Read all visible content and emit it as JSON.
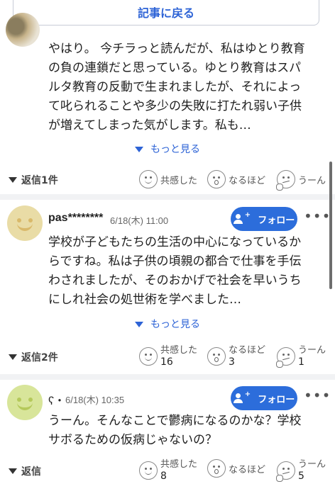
{
  "header": {
    "back_label": "記事に戻る"
  },
  "comments": [
    {
      "lines": [
        "やはり。 今チラっと読んだが、私はゆとり教育",
        "の負の連鎖だと思っている。ゆとり教育はスパ",
        "ルタ教育の反動で生まれましたが、それによっ",
        "て叱られることや多少の失敗に打たれ弱い子供",
        "が増えてしまった気がします。私も…"
      ],
      "more_label": "もっと見る",
      "reply_label": "返信1件",
      "reactions": {
        "empathy": {
          "label": "共感した"
        },
        "insight": {
          "label": "なるほど"
        },
        "hmm": {
          "label": "うーん"
        }
      }
    },
    {
      "username": "pas********",
      "date": "6/18(木) 11:00",
      "follow_label": "フォロー",
      "lines": [
        "学校が子どもたちの生活の中心になっているか",
        "らですね。私は子供の頃親の都合で仕事を手伝",
        "わされましたが、そのおかげで社会を早いうち",
        "にしれ社会の処世術を学べました…"
      ],
      "more_label": "もっと見る",
      "reply_label": "返信2件",
      "reactions": {
        "empathy": {
          "label": "共感した",
          "count": "16"
        },
        "insight": {
          "label": "なるほど",
          "count": "3"
        },
        "hmm": {
          "label": "うーん",
          "count": "1"
        }
      }
    },
    {
      "username": "ʕ・",
      "date": "6/18(木) 10:35",
      "follow_label": "フォロー",
      "lines": [
        "うーん。そんなことで鬱病になるのかな？学校",
        "サボるための仮病じゃないの？"
      ],
      "reply_label": "返信",
      "reactions": {
        "empathy": {
          "label": "共感した",
          "count": "8"
        },
        "insight": {
          "label": "なるほど"
        },
        "hmm": {
          "label": "うーん",
          "count": "5"
        }
      }
    }
  ],
  "more_dots": "•••"
}
